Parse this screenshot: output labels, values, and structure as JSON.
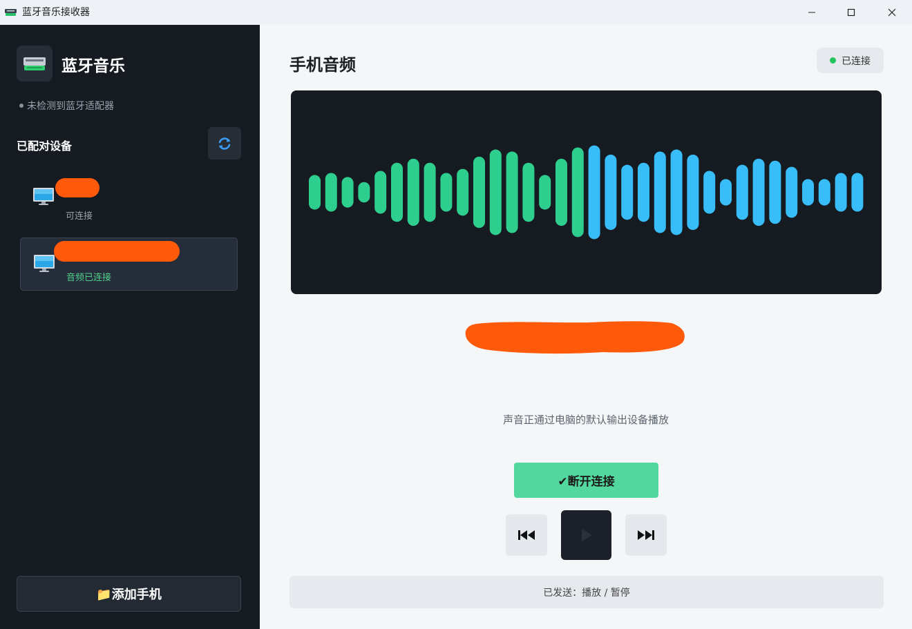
{
  "window": {
    "title": "蓝牙音乐接收器"
  },
  "sidebar": {
    "brand": "蓝牙音乐",
    "adapter_status": "未检测到蓝牙适配器",
    "paired_title": "已配对设备",
    "devices": [
      {
        "status": "可连接"
      },
      {
        "status": "音频已连接"
      }
    ],
    "add_phone_label": "📁添加手机"
  },
  "main": {
    "title": "手机音频",
    "connection_badge": "已连接",
    "hint": "声音正通过电脑的默认输出设备播放",
    "disconnect_label": "✔断开连接",
    "status_message": "已发送：播放 / 暂停"
  },
  "colors": {
    "sidebar_bg": "#161b22",
    "visualizer_green": "#2ecf8e",
    "visualizer_blue": "#38bdf8",
    "disconnect_green": "#52d89e",
    "status_dot": "#22c55e",
    "redaction": "#ff5a0a"
  },
  "visualizer": {
    "bar_levels": [
      0.17,
      0.19,
      0.15,
      0.1,
      0.21,
      0.29,
      0.33,
      0.29,
      0.19,
      0.23,
      0.35,
      0.42,
      0.4,
      0.29,
      0.17,
      0.33,
      0.44,
      0.46,
      0.37,
      0.27,
      0.29,
      0.4,
      0.42,
      0.37,
      0.21,
      0.13,
      0.27,
      0.33,
      0.31,
      0.25,
      0.13,
      0.13,
      0.19,
      0.19
    ],
    "blue_from_index": 17
  }
}
